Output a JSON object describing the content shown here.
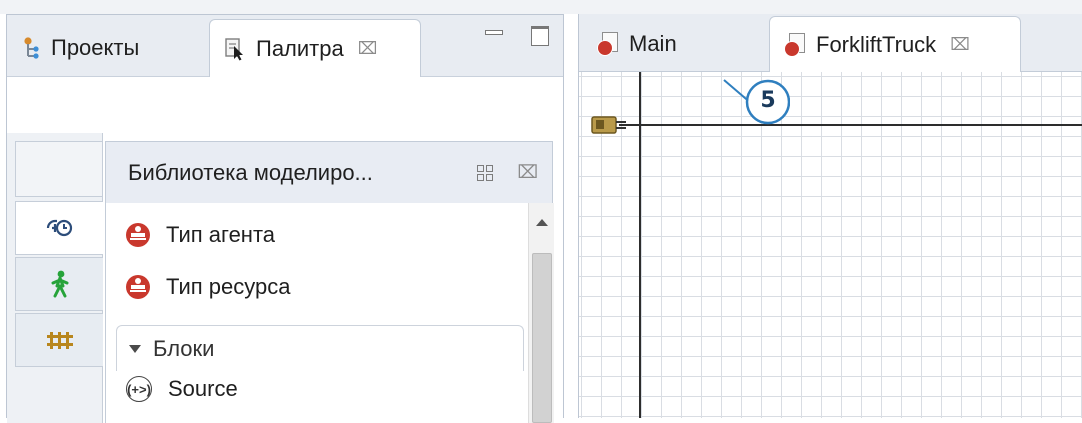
{
  "left_view": {
    "tabs": [
      {
        "label": "Проекты",
        "icon": "projects-tree-icon"
      },
      {
        "label": "Палитра",
        "icon": "palette-icon",
        "active": true
      }
    ],
    "close_glyph": "⌧",
    "window_buttons": [
      "minimize-icon",
      "maximize-icon"
    ]
  },
  "palette": {
    "categories": [
      {
        "icon": "process-modeling-icon",
        "active": true
      },
      {
        "icon": "pedestrian-icon"
      },
      {
        "icon": "rail-library-icon"
      }
    ],
    "library": {
      "title": "Библиотека моделиро...",
      "close_glyph": "⌧",
      "items": [
        {
          "label": "Тип агента",
          "icon": "agent-type-icon"
        },
        {
          "label": "Тип ресурса",
          "icon": "resource-type-icon"
        }
      ],
      "section": {
        "label": "Блоки",
        "expanded": true
      },
      "blocks": [
        {
          "label": "Source",
          "icon": "source-block-icon",
          "icon_glyph": "(+>)"
        }
      ]
    }
  },
  "editor": {
    "tabs": [
      {
        "label": "Main",
        "icon": "agent-document-icon"
      },
      {
        "label": "ForkliftTruck",
        "icon": "agent-document-icon",
        "active": true
      }
    ],
    "close_glyph": "⌧"
  },
  "callout": {
    "number": "5"
  },
  "colors": {
    "accent_red": "#c9382d",
    "callout": "#2f7fbf",
    "grid": "#d9dde3"
  }
}
